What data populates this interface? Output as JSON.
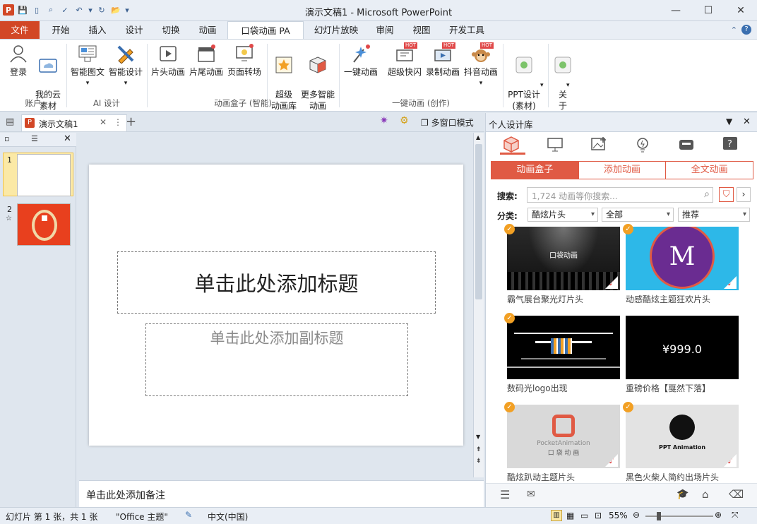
{
  "app_title": "演示文稿1 - Microsoft PowerPoint",
  "window": {
    "min": "—",
    "max": "☐",
    "close": "✕"
  },
  "tabs": [
    {
      "label": "文件"
    },
    {
      "label": "开始"
    },
    {
      "label": "插入"
    },
    {
      "label": "设计"
    },
    {
      "label": "切换"
    },
    {
      "label": "动画"
    },
    {
      "label": "口袋动画 PA"
    },
    {
      "label": "幻灯片放映"
    },
    {
      "label": "审阅"
    },
    {
      "label": "视图"
    },
    {
      "label": "开发工具"
    }
  ],
  "ribbon": {
    "btn_login": "登录",
    "btn_cloud": "我的云\n素材",
    "btn_smart_text": "智能图文",
    "btn_smart_design": "智能设计",
    "btn_intro": "片头动画",
    "btn_outro": "片尾动画",
    "btn_page_turn": "页面转场",
    "btn_super_lib": "超级\n动画库",
    "btn_more_smart": "更多智能\n动画",
    "btn_one_click": "一键动画",
    "btn_super_flash": "超级快闪",
    "btn_record": "录制动画",
    "btn_douyin": "抖音动画",
    "btn_ppt_design": "PPT设计\n(素材)",
    "btn_about": "关\n于",
    "hot": "HOT",
    "groups": {
      "account": "账户",
      "ai": "AI 设计",
      "box": "动画盒子 (智能)",
      "one_click": "一键动画 (创作)"
    }
  },
  "doc_tab": {
    "name": "演示文稿1",
    "multiwin": "多窗口模式"
  },
  "slides": [
    {
      "num": "1"
    },
    {
      "num": "2"
    }
  ],
  "slide": {
    "title_ph": "单击此处添加标题",
    "subtitle_ph": "单击此处添加副标题"
  },
  "notes_ph": "单击此处添加备注",
  "panel": {
    "title": "个人设计库",
    "subtabs": [
      "动画盒子",
      "添加动画",
      "全文动画"
    ],
    "search_label": "搜索:",
    "search_placeholder": "1,724 动画等你搜索...",
    "cat_label": "分类:",
    "cat_value": "酷炫片头",
    "filter_value": "全部",
    "sort_value": "推荐",
    "cards": [
      {
        "caption": "霸气展台聚光灯片头",
        "overlay": "口袋动画"
      },
      {
        "caption": "动感酷炫主题狂欢片头",
        "overlay": "M"
      },
      {
        "caption": "数码光logo出现",
        "overlay": ""
      },
      {
        "caption": "重磅价格【戛然下落】",
        "overlay": "¥999.0"
      },
      {
        "caption": "酷炫趴动主题片头",
        "overlay": "PocketAnimation",
        "overlay2": "口 袋 动 画"
      },
      {
        "caption": "黑色火柴人简约出场片头",
        "overlay": "PPT Animation"
      }
    ]
  },
  "status": {
    "slide_info": "幻灯片 第 1 张，共 1 张",
    "theme": "\"Office 主题\"",
    "lang": "中文(中国)",
    "zoom": "55%"
  },
  "colors": {
    "accent": "#d24726",
    "panel_red": "#e05a44",
    "orange": "#f2a024"
  }
}
